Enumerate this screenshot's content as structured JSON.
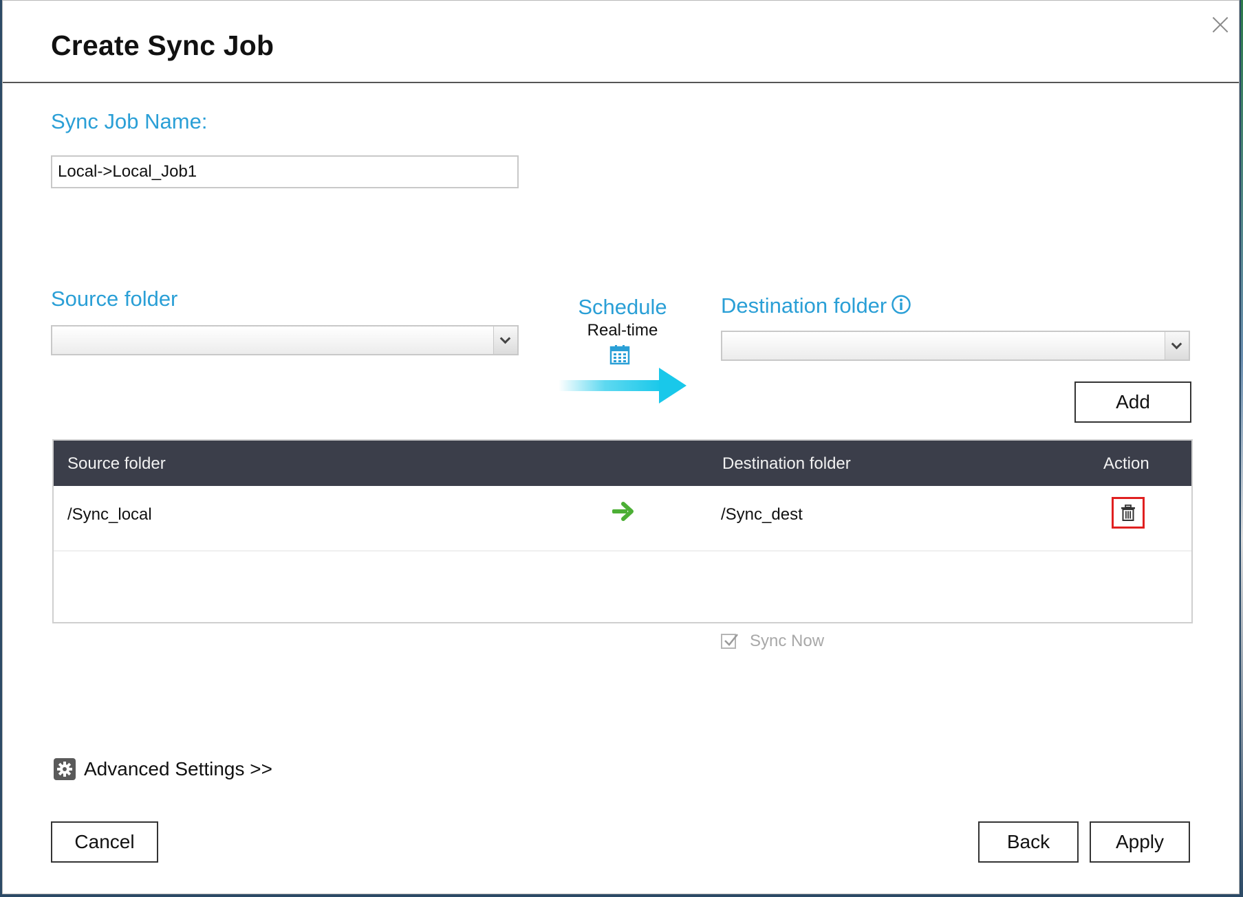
{
  "dialog": {
    "title": "Create Sync Job",
    "close_icon": "close-icon"
  },
  "job_name": {
    "label": "Sync Job Name:",
    "value": "Local->Local_Job1"
  },
  "source": {
    "label": "Source folder",
    "selected": ""
  },
  "schedule": {
    "label": "Schedule",
    "value": "Real-time",
    "icon": "calendar-icon"
  },
  "destination": {
    "label": "Destination folder",
    "selected": "",
    "info_icon": "info-icon"
  },
  "add_button": "Add",
  "table": {
    "headers": {
      "source": "Source folder",
      "destination": "Destination folder",
      "action": "Action"
    },
    "rows": [
      {
        "source": "/Sync_local",
        "destination": "/Sync_dest",
        "action_icon": "trash-icon"
      }
    ]
  },
  "sync_now": {
    "label": "Sync Now",
    "checked": true
  },
  "advanced_settings": {
    "label": "Advanced Settings >>",
    "icon": "gear-icon"
  },
  "footer": {
    "cancel": "Cancel",
    "back": "Back",
    "apply": "Apply"
  },
  "colors": {
    "accent": "#2a9fd6",
    "header_bg": "#3b3e4a",
    "arrow_cyan": "#19c8ea",
    "row_arrow_green": "#4caf35",
    "delete_highlight": "#e02020"
  }
}
